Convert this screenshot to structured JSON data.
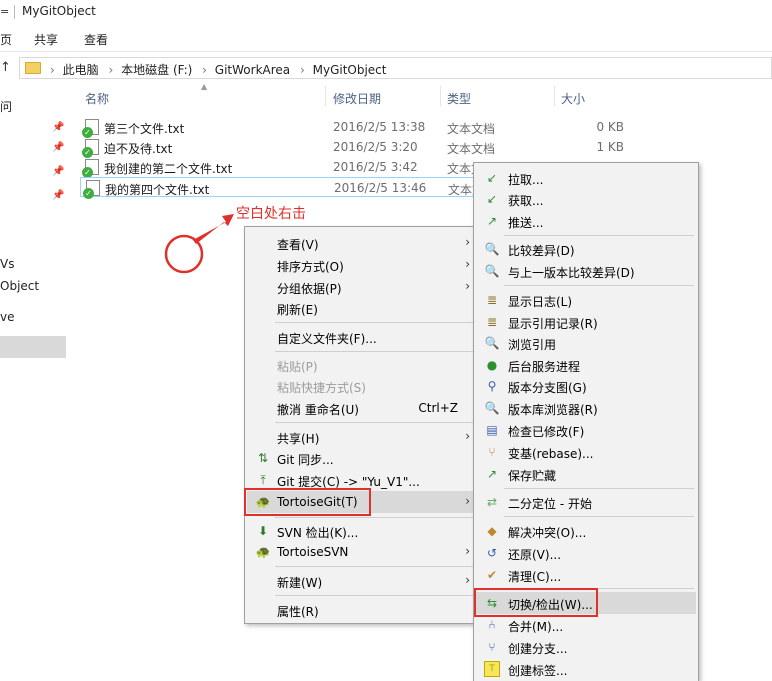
{
  "window": {
    "title": "MyGitObject",
    "sys_glyph": "="
  },
  "ribbon": {
    "tabs": [
      "页",
      "共享",
      "查看"
    ]
  },
  "address": {
    "up_glyph": "↑",
    "crumbs": [
      "此电脑",
      "本地磁盘 (F:)",
      "GitWorkArea",
      "MyGitObject"
    ]
  },
  "nav": {
    "items": [
      "问",
      "Vs",
      "Object",
      "ve"
    ]
  },
  "columns": {
    "name": "名称",
    "date": "修改日期",
    "type": "类型",
    "size": "大小"
  },
  "files": [
    {
      "name": "第三个文件.txt",
      "date": "2016/2/5 13:38",
      "type": "文本文档",
      "size": "0 KB"
    },
    {
      "name": "迫不及待.txt",
      "date": "2016/2/5 3:20",
      "type": "文本文档",
      "size": "1 KB"
    },
    {
      "name": "我创建的第二个文件.txt",
      "date": "2016/2/5 3:42",
      "type": "文本文档",
      "size": ""
    },
    {
      "name": "我的第四个文件.txt",
      "date": "2016/2/5 13:46",
      "type": "文本文档",
      "size": ""
    }
  ],
  "annotation": {
    "text": "空白处右击"
  },
  "context_menu": {
    "view": "查看(V)",
    "sort": "排序方式(O)",
    "group": "分组依据(P)",
    "refresh": "刷新(E)",
    "customize": "自定义文件夹(F)...",
    "paste": "粘贴(P)",
    "paste_shortcut": "粘贴快捷方式(S)",
    "undo": "撤消 重命名(U)",
    "undo_shortcut": "Ctrl+Z",
    "share": "共享(H)",
    "git_sync": "Git 同步...",
    "git_commit": "Git 提交(C) -> \"Yu_V1\"...",
    "tortoisegit": "TortoiseGit(T)",
    "svn_checkout": "SVN 检出(K)...",
    "tortoisesvn": "TortoiseSVN",
    "new": "新建(W)",
    "properties": "属性(R)"
  },
  "git_submenu": {
    "pull": "拉取...",
    "fetch": "获取...",
    "push": "推送...",
    "diff": "比较差异(D)",
    "diff_prev": "与上一版本比较差异(D)",
    "log": "显示日志(L)",
    "reflog": "显示引用记录(R)",
    "browse_refs": "浏览引用",
    "daemon": "后台服务进程",
    "revision_graph": "版本分支图(G)",
    "repo_browser": "版本库浏览器(R)",
    "check_modifications": "检查已修改(F)",
    "rebase": "变基(rebase)...",
    "stash": "保存贮藏",
    "bisect": "二分定位 - 开始",
    "resolve": "解决冲突(O)...",
    "revert": "还原(V)...",
    "cleanup": "清理(C)...",
    "switch": "切换/检出(W)...",
    "merge": "合并(M)...",
    "create_branch": "创建分支...",
    "create_tag": "创建标签..."
  },
  "colors": {
    "accent_red": "#e0302b",
    "menu_bg": "#f2f2f2",
    "highlight": "#d9d9d9",
    "header_text": "#4d6185"
  }
}
